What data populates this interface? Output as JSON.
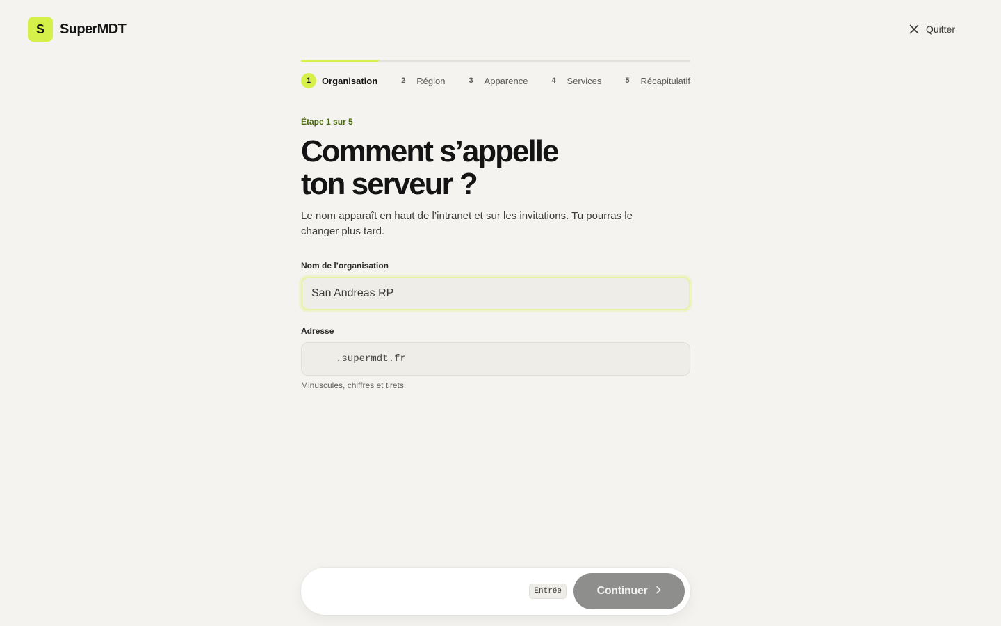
{
  "app": {
    "brand_initial": "S",
    "brand_name": "SuperMDT",
    "quit_label": "Quitter"
  },
  "progress": {
    "current_step": 1,
    "total_steps": 5,
    "fraction": 0.2
  },
  "steps": [
    {
      "num": "1",
      "label": "Organisation"
    },
    {
      "num": "2",
      "label": "Région"
    },
    {
      "num": "3",
      "label": "Apparence"
    },
    {
      "num": "4",
      "label": "Services"
    },
    {
      "num": "5",
      "label": "Récapitulatif"
    }
  ],
  "main": {
    "kicker": "Étape 1 sur 5",
    "headline_line1": "Comment s’appelle",
    "headline_line2": "ton serveur ?",
    "lead": "Le nom apparaît en haut de l’intranet et sur les invitations. Tu pourras le changer plus tard."
  },
  "form": {
    "org_label": "Nom de l’organisation",
    "org_value": "San Andreas RP",
    "address_label": "Adresse",
    "address_value": "",
    "address_suffix": ".supermdt.fr",
    "address_hint": "Minuscules, chiffres et tirets."
  },
  "footer": {
    "kbd_label": "Entrée",
    "continue_label": "Continuer"
  },
  "colors": {
    "accent": "#d6f04a",
    "background": "#f4f3ef",
    "kicker": "#4a6a10",
    "button_disabled": "#8e8e8c"
  },
  "icons": {
    "quit": "close-icon",
    "continue": "chevron-right-icon"
  }
}
